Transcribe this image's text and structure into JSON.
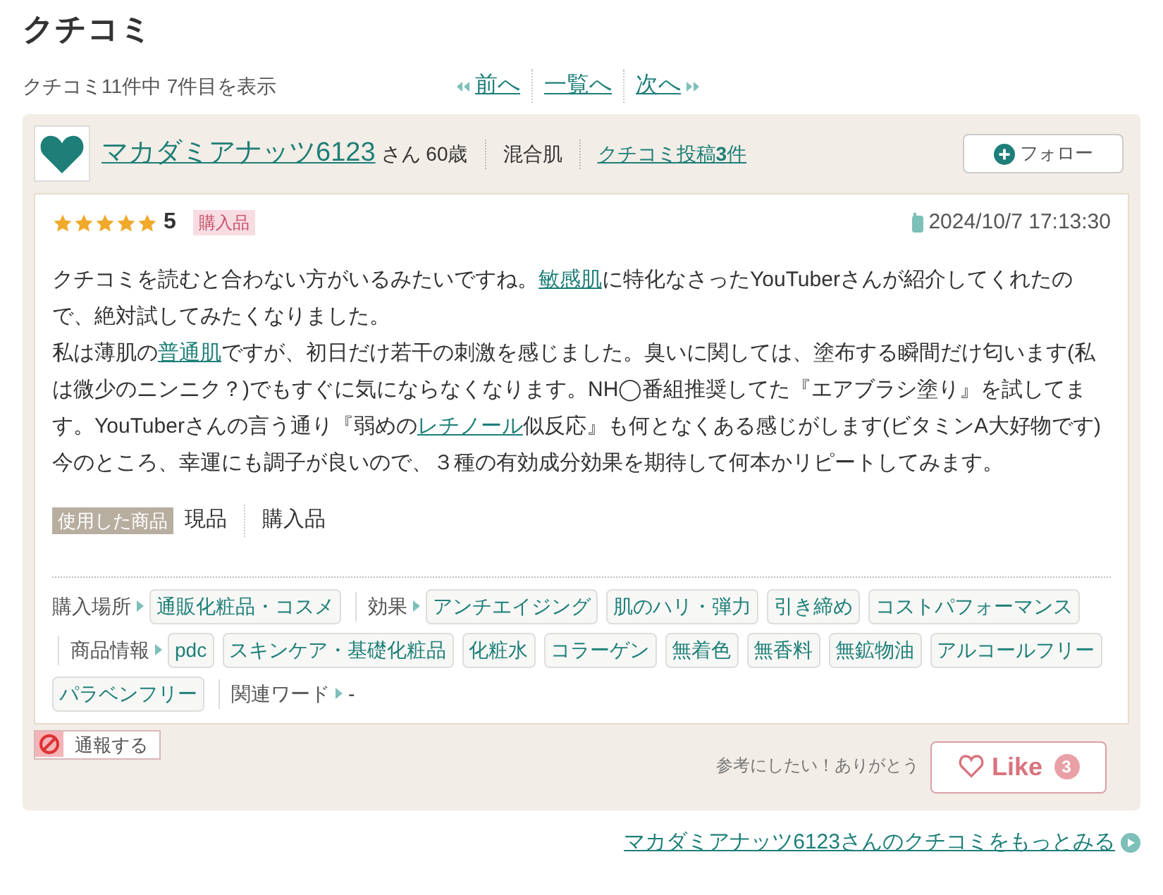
{
  "heading": "クチコミ",
  "counter": "クチコミ11件中 7件目を表示",
  "pager": [
    {
      "label": "前へ",
      "kind": "prev"
    },
    {
      "label": "一覧へ",
      "kind": "list"
    },
    {
      "label": "次へ",
      "kind": "next"
    }
  ],
  "reviewer": {
    "name": "マカダミアナッツ6123",
    "suffix": "さん",
    "age": "60歳",
    "skin": "混合肌",
    "posts": "クチコミ投稿**3**件",
    "follow": "フォロー"
  },
  "review": {
    "stars": 5,
    "rating": "5",
    "badge": "購入品",
    "date": "2024/10/7 17:13:30",
    "paragraphs": [
      [
        {
          "text": "クチコミを読むと合わない方がいるみたいですね。"
        },
        {
          "text": "敏感肌",
          "link": true
        },
        {
          "text": "に特化なさったYouTuberさんが紹介してくれたので、絶対試してみたくなりました。"
        }
      ],
      [
        {
          "text": "私は薄肌の"
        },
        {
          "text": "普通肌",
          "link": true
        },
        {
          "text": "ですが、初日だけ若干の刺激を感じました。臭いに関しては、塗布する瞬間だけ匂います(私は微少のニンニク？)でもすぐに気にならなくなります。NH◯番組推奨してた『エアブラシ塗り』を試してます。YouTuberさんの言う通り『弱めの"
        },
        {
          "text": "レチノール",
          "link": true
        },
        {
          "text": "似反応』も何となくある感じがします(ビタミンA大好物です)"
        }
      ],
      [
        {
          "text": "今のところ、幸運にも調子が良いので、３種の有効成分効果を期待して何本かリピートしてみます。"
        }
      ]
    ],
    "used_label": "使用した商品",
    "used": [
      "現品",
      "購入品"
    ],
    "tag_groups": [
      {
        "label": "購入場所",
        "tags": [
          "通販化粧品・コスメ"
        ]
      },
      {
        "label": "効果",
        "tags": [
          "アンチエイジング",
          "肌のハリ・弾力",
          "引き締め",
          "コストパフォーマンス"
        ]
      },
      {
        "label": "商品情報",
        "tags": [
          "pdc",
          "スキンケア・基礎化粧品",
          "化粧水",
          "コラーゲン",
          "無着色",
          "無香料",
          "無鉱物油",
          "アルコールフリー",
          "パラベンフリー"
        ]
      },
      {
        "label": "関連ワード",
        "value": "-"
      }
    ]
  },
  "report": "通報する",
  "thanks": "参考にしたい！ありがとう",
  "like": {
    "label": "Like",
    "count": "3"
  },
  "more": "マカダミアナッツ6123さんのクチコミをもっとみる"
}
